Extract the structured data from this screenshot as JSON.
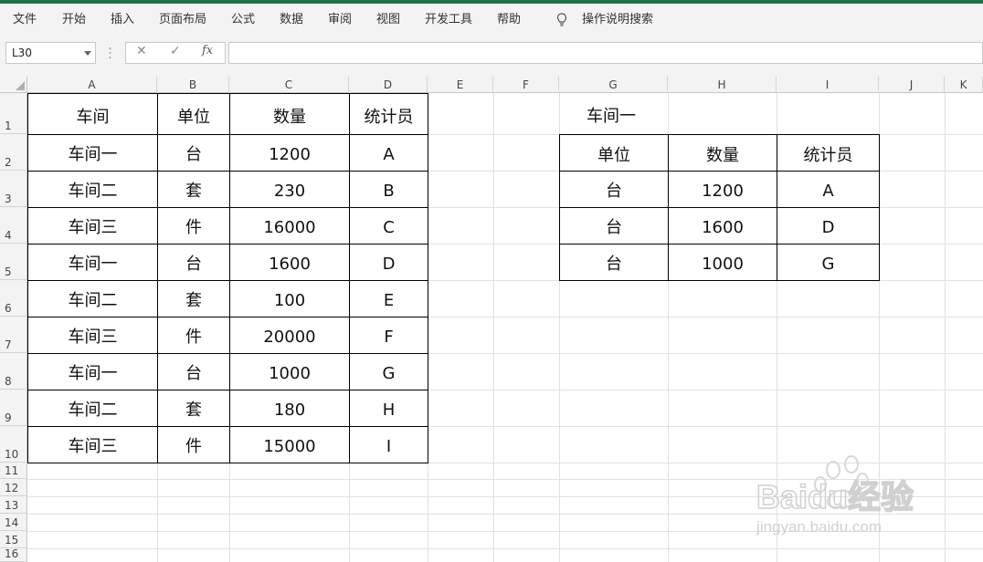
{
  "ribbon": {
    "tabs": [
      "文件",
      "开始",
      "插入",
      "页面布局",
      "公式",
      "数据",
      "审阅",
      "视图",
      "开发工具",
      "帮助"
    ],
    "search_label": "操作说明搜索",
    "accent_color": "#217346"
  },
  "formula_bar": {
    "name_box": "L30",
    "cancel_icon": "✕",
    "enter_icon": "✓",
    "fx_label": "fx",
    "formula": ""
  },
  "sheet": {
    "columns": [
      "A",
      "B",
      "C",
      "D",
      "E",
      "F",
      "G",
      "H",
      "I",
      "J",
      "K"
    ],
    "rows": [
      "1",
      "2",
      "3",
      "4",
      "5",
      "6",
      "7",
      "8",
      "9",
      "10",
      "11",
      "12",
      "13",
      "14",
      "15",
      "16"
    ],
    "table1": {
      "headers": [
        "车间",
        "单位",
        "数量",
        "统计员"
      ],
      "rows": [
        [
          "车间一",
          "台",
          "1200",
          "A"
        ],
        [
          "车间二",
          "套",
          "230",
          "B"
        ],
        [
          "车间三",
          "件",
          "16000",
          "C"
        ],
        [
          "车间一",
          "台",
          "1600",
          "D"
        ],
        [
          "车间二",
          "套",
          "100",
          "E"
        ],
        [
          "车间三",
          "件",
          "20000",
          "F"
        ],
        [
          "车间一",
          "台",
          "1000",
          "G"
        ],
        [
          "车间二",
          "套",
          "180",
          "H"
        ],
        [
          "车间三",
          "件",
          "15000",
          "I"
        ]
      ]
    },
    "table2": {
      "title": "车间一",
      "headers": [
        "单位",
        "数量",
        "统计员"
      ],
      "rows": [
        [
          "台",
          "1200",
          "A"
        ],
        [
          "台",
          "1600",
          "D"
        ],
        [
          "台",
          "1000",
          "G"
        ]
      ]
    }
  },
  "watermark": {
    "brand": "Baidu经验",
    "url": "jingyan.baidu.com"
  }
}
